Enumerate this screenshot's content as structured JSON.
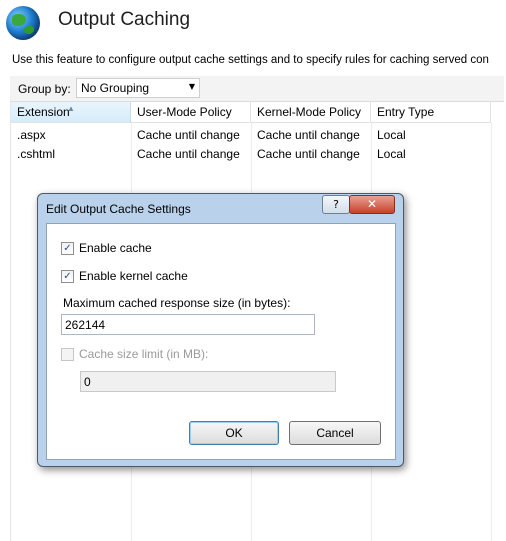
{
  "header": {
    "icon": "globe-icon",
    "title": "Output Caching",
    "description": "Use this feature to configure output cache settings and to specify rules for caching served con"
  },
  "toolbar": {
    "group_by_label": "Group by:",
    "group_by_value": "No Grouping"
  },
  "table": {
    "columns": [
      "Extension",
      "User-Mode Policy",
      "Kernel-Mode Policy",
      "Entry Type"
    ],
    "rows": [
      [
        ".aspx",
        "Cache until change",
        "Cache until change",
        "Local"
      ],
      [
        ".cshtml",
        "Cache until change",
        "Cache until change",
        "Local"
      ]
    ]
  },
  "dialog": {
    "title": "Edit Output Cache Settings",
    "help_glyph": "?",
    "close_glyph": "✕",
    "enable_cache_label": "Enable cache",
    "enable_cache_checked": true,
    "enable_kernel_cache_label": "Enable kernel cache",
    "enable_kernel_cache_checked": true,
    "max_size_label": "Maximum cached response size (in bytes):",
    "max_size_value": "262144",
    "cache_limit_label": "Cache size limit (in MB):",
    "cache_limit_checked": false,
    "cache_limit_value": "0",
    "ok_label": "OK",
    "cancel_label": "Cancel"
  }
}
